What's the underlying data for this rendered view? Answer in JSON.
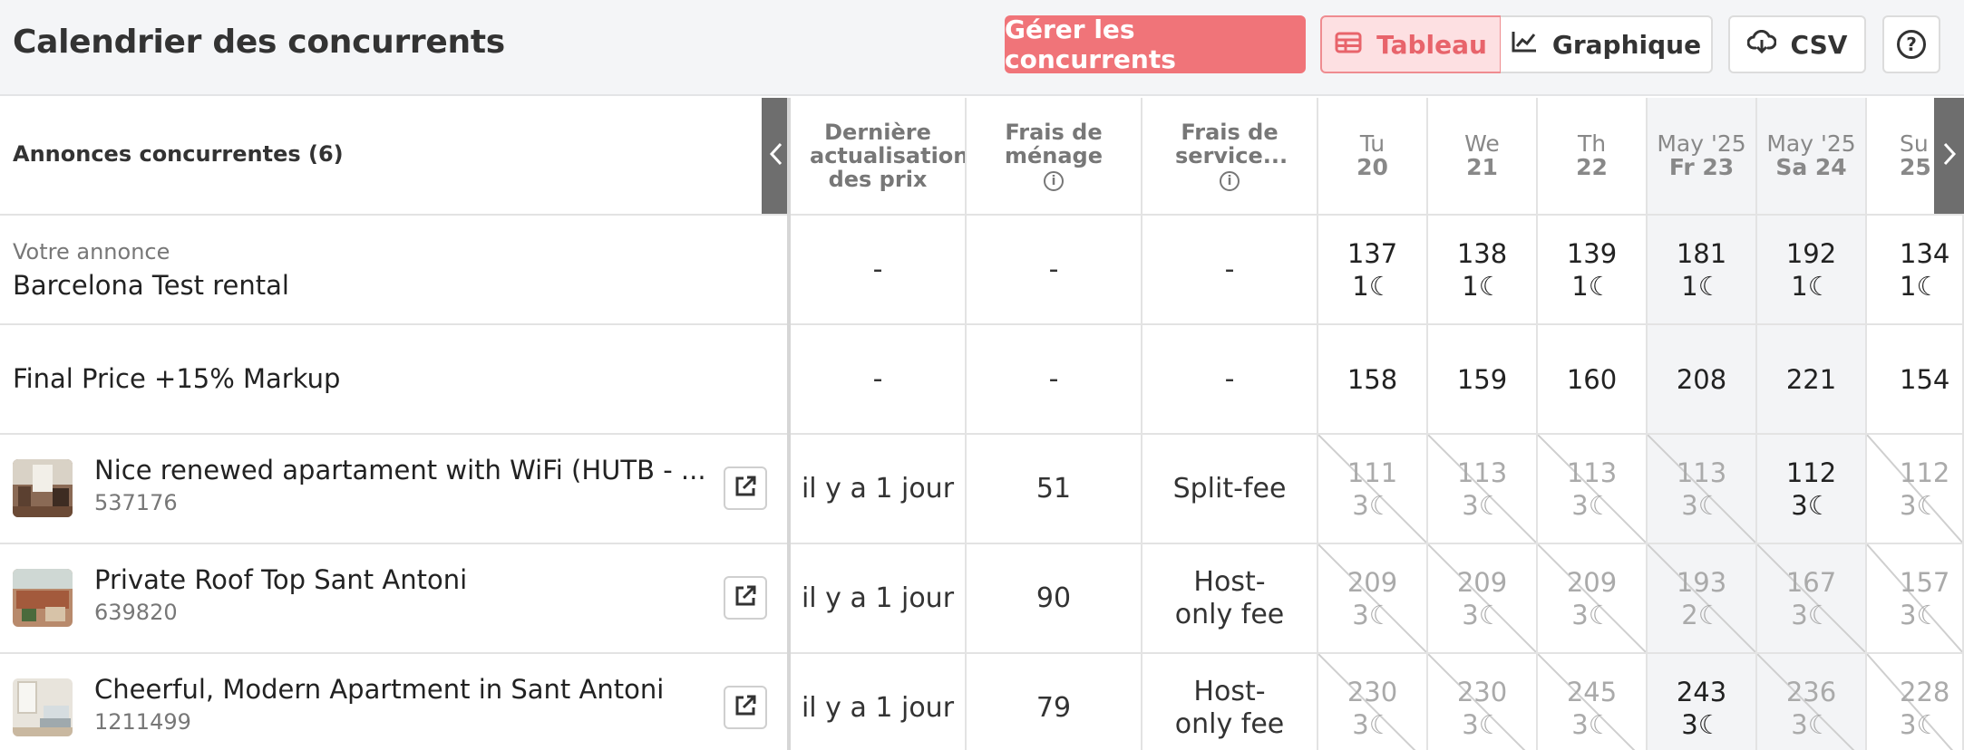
{
  "header": {
    "title": "Calendrier des concurrents",
    "manage_label": "Gérer les concurrents",
    "table_label": "Tableau",
    "chart_label": "Graphique",
    "csv_label": "CSV",
    "help_label": "?"
  },
  "columns": {
    "listings_header": "Annonces concurrentes (6)",
    "last_update": "Dernière actualisation des prix",
    "cleaning_fee": "Frais de ménage",
    "service_fee": "Frais de service...",
    "info_glyph": "i"
  },
  "dates": [
    {
      "top": "Tu",
      "bottom": "20"
    },
    {
      "top": "We",
      "bottom": "21"
    },
    {
      "top": "Th",
      "bottom": "22"
    },
    {
      "top": "May '25",
      "bottom": "Fr 23"
    },
    {
      "top": "May '25",
      "bottom": "Sa 24"
    },
    {
      "top": "Su",
      "bottom": "25"
    }
  ],
  "rows": {
    "your_listing": {
      "label": "Votre annonce",
      "name": "Barcelona Test rental",
      "last_update": "-",
      "cleaning": "-",
      "service": "-",
      "prices": [
        "137",
        "138",
        "139",
        "181",
        "192",
        "134"
      ],
      "nights": [
        "1",
        "1",
        "1",
        "1",
        "1",
        "1"
      ]
    },
    "final_price": {
      "name": "Final Price +15% Markup",
      "last_update": "-",
      "cleaning": "-",
      "service": "-",
      "prices": [
        "158",
        "159",
        "160",
        "208",
        "221",
        "154"
      ]
    },
    "competitors": [
      {
        "title": "Nice renewed apartament with WiFi (HUTB - ...",
        "id": "537176",
        "last_update": "il y a 1 jour",
        "cleaning": "51",
        "service": "Split-fee",
        "prices": [
          "111",
          "113",
          "113",
          "113",
          "112",
          "112"
        ],
        "nights": [
          "3",
          "3",
          "3",
          "3",
          "3",
          "3"
        ],
        "available": [
          false,
          false,
          false,
          false,
          true,
          false
        ]
      },
      {
        "title": "Private Roof Top Sant Antoni",
        "id": "639820",
        "last_update": "il y a 1 jour",
        "cleaning": "90",
        "service": "Host-only fee",
        "prices": [
          "209",
          "209",
          "209",
          "193",
          "167",
          "157"
        ],
        "nights": [
          "3",
          "3",
          "3",
          "2",
          "3",
          "3"
        ],
        "available": [
          false,
          false,
          false,
          false,
          false,
          false
        ]
      },
      {
        "title": "Cheerful, Modern Apartment in Sant Antoni",
        "id": "1211499",
        "last_update": "il y a 1 jour",
        "cleaning": "79",
        "service": "Host-only fee",
        "prices": [
          "230",
          "230",
          "245",
          "243",
          "236",
          "228"
        ],
        "nights": [
          "3",
          "3",
          "3",
          "3",
          "3",
          "3"
        ],
        "available": [
          false,
          false,
          false,
          true,
          false,
          false
        ]
      }
    ]
  },
  "moon_glyph": "☾",
  "icons": {
    "table": "table-icon",
    "chart": "line-chart-icon",
    "csv": "cloud-download-icon",
    "help": "help-icon",
    "external": "external-link-icon",
    "collapse": "chevron-left-icon",
    "scroll_right": "chevron-right-icon"
  },
  "colors": {
    "brand": "#f07479",
    "brand_light": "#fde0e2",
    "weekend_shade": "#f3f4f6"
  }
}
